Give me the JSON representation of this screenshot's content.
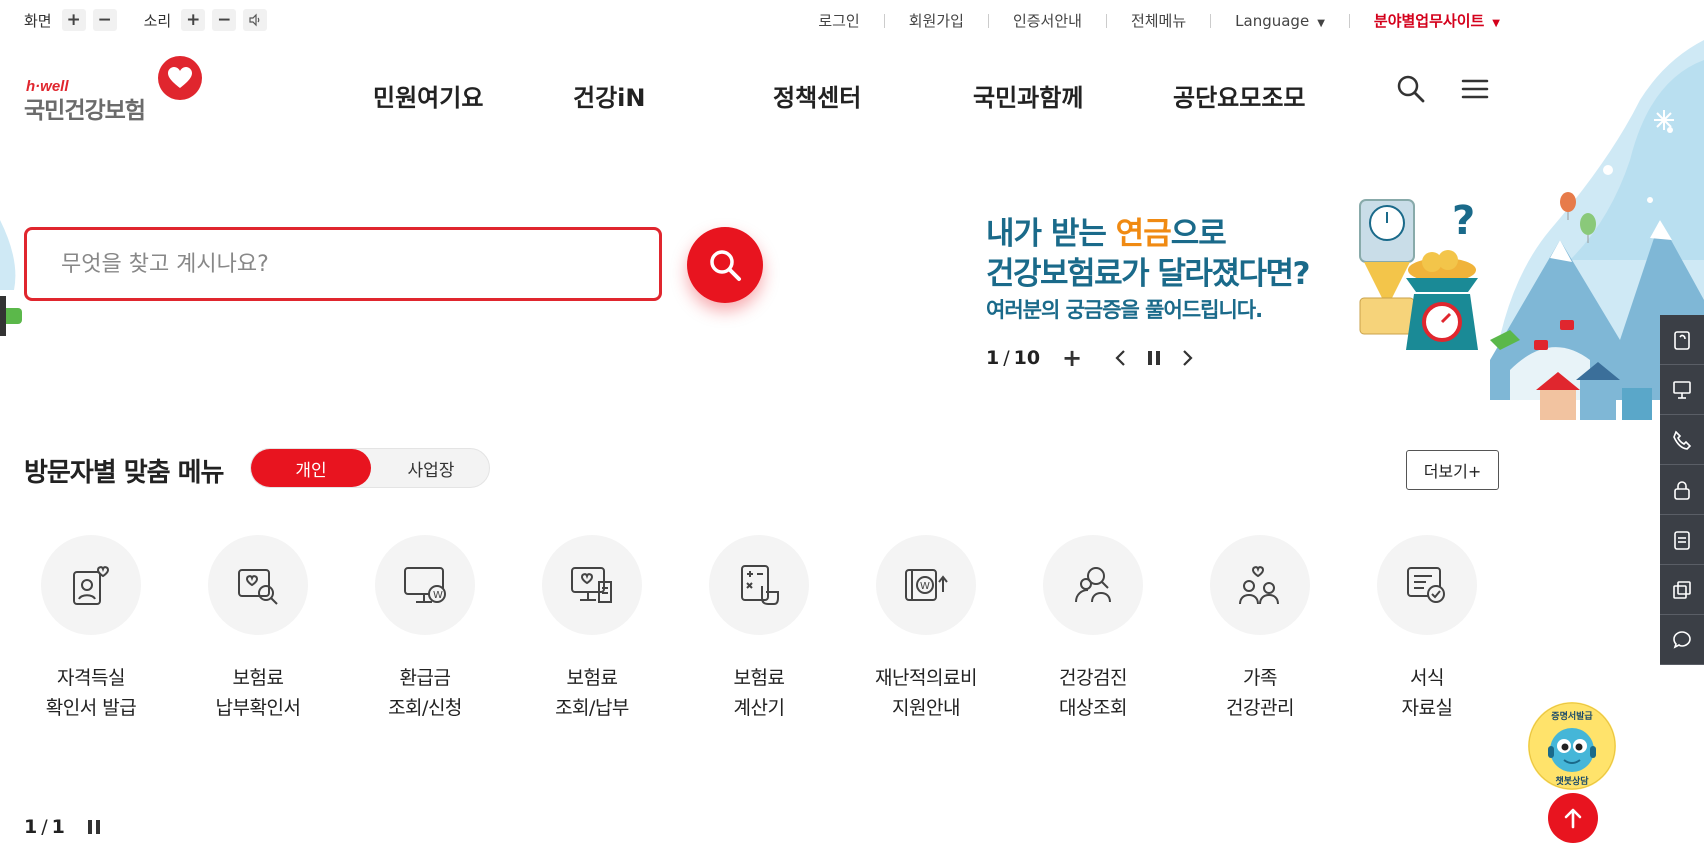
{
  "utility": {
    "screen_label": "화면",
    "sound_label": "소리",
    "plus": "+",
    "minus": "−",
    "links": [
      "로그인",
      "회원가입",
      "인증서안내",
      "전체메뉴",
      "Language"
    ],
    "field_sites": "분야별업무사이트",
    "caret": "▼"
  },
  "logo": {
    "tagline": "h·well",
    "name": "국민건강보험"
  },
  "gnb": {
    "items": [
      "민원여기요",
      "건강iN",
      "정책센터",
      "국민과함께",
      "공단요모조모"
    ]
  },
  "search": {
    "placeholder": "무엇을 찾고 계시나요?"
  },
  "banner": {
    "line1_a": "내가 받는 ",
    "line1_b": "연금",
    "line1_c": "으로",
    "line2": "건강보험료가 달라졌다면?",
    "line3": "여러분의 궁금증을 풀어드립니다.",
    "current": "1",
    "slash": "/",
    "total": "10",
    "plus": "+"
  },
  "quick_menu": {
    "title": "방문자별 맞춤 메뉴",
    "tab_personal": "개인",
    "tab_business": "사업장",
    "more": "더보기+",
    "items": [
      {
        "label": "자격득실\n확인서 발급",
        "icon": "certificate-person-icon"
      },
      {
        "label": "보험료\n납부확인서",
        "icon": "search-document-icon"
      },
      {
        "label": "환급금\n조회/신청",
        "icon": "refund-monitor-icon"
      },
      {
        "label": "보험료\n조회/납부",
        "icon": "payment-monitor-icon"
      },
      {
        "label": "보험료\n계산기",
        "icon": "calculator-icon"
      },
      {
        "label": "재난적의료비\n지원안내",
        "icon": "medical-support-icon"
      },
      {
        "label": "건강검진\n대상조회",
        "icon": "checkup-people-icon"
      },
      {
        "label": "가족\n건강관리",
        "icon": "family-care-icon"
      },
      {
        "label": "서식\n자료실",
        "icon": "form-library-icon"
      }
    ],
    "page_current": "1",
    "page_slash": "/",
    "page_total": "1"
  },
  "chatbot": {
    "top": "증명서발급",
    "bottom": "챗봇상담"
  },
  "colors": {
    "accent": "#e8141f",
    "banner_text": "#1a6a8a",
    "banner_highlight": "#f08a12",
    "sidebar": "#3b3f46"
  }
}
